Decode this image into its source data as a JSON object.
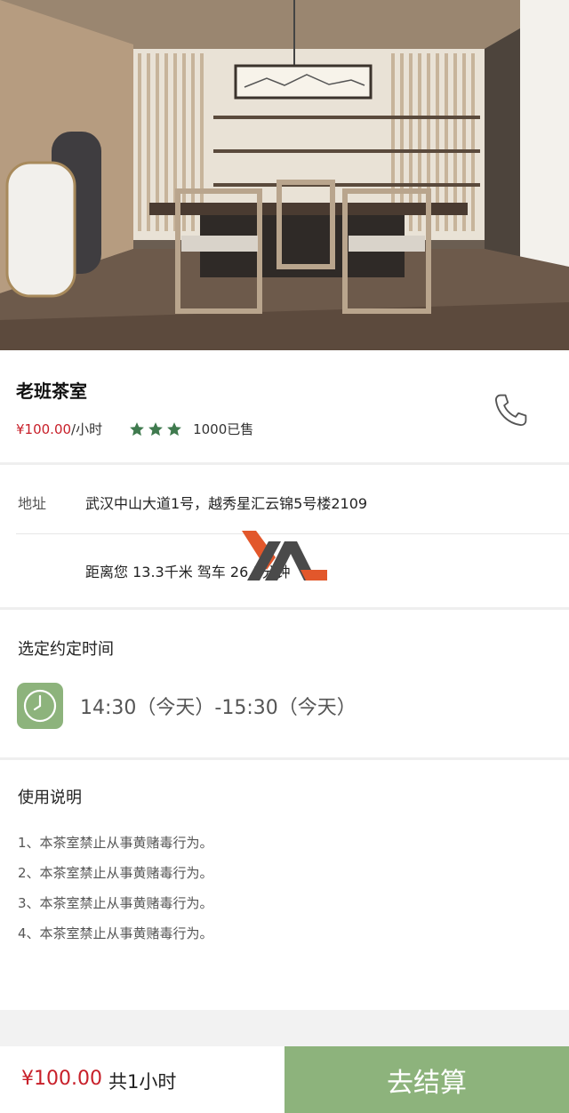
{
  "shop": {
    "name": "老班茶室",
    "price": "¥100.00",
    "unit": "/小时",
    "rating": 3,
    "sold": "1000已售"
  },
  "address": {
    "label": "地址",
    "value": "武汉中山大道1号，越秀星汇云锦5号楼2109",
    "distance": "距离您 13.3千米    驾车 26.5分钟"
  },
  "booking": {
    "title": "选定约定时间",
    "time": "14:30（今天）-15:30（今天）"
  },
  "rules": {
    "title": "使用说明",
    "items": [
      "1、本茶室禁止从事黄赌毒行为。",
      "2、本茶室禁止从事黄赌毒行为。",
      "3、本茶室禁止从事黄赌毒行为。",
      "4、本茶室禁止从事黄赌毒行为。"
    ]
  },
  "footer": {
    "total_price": "¥100.00",
    "total_hours": "共1小时",
    "checkout_label": "去结算"
  },
  "colors": {
    "accent_green": "#8db37c",
    "star_green": "#3f7a4e",
    "price_red": "#c8202a"
  },
  "icons": [
    "phone-icon",
    "star-icon",
    "clock-icon"
  ]
}
